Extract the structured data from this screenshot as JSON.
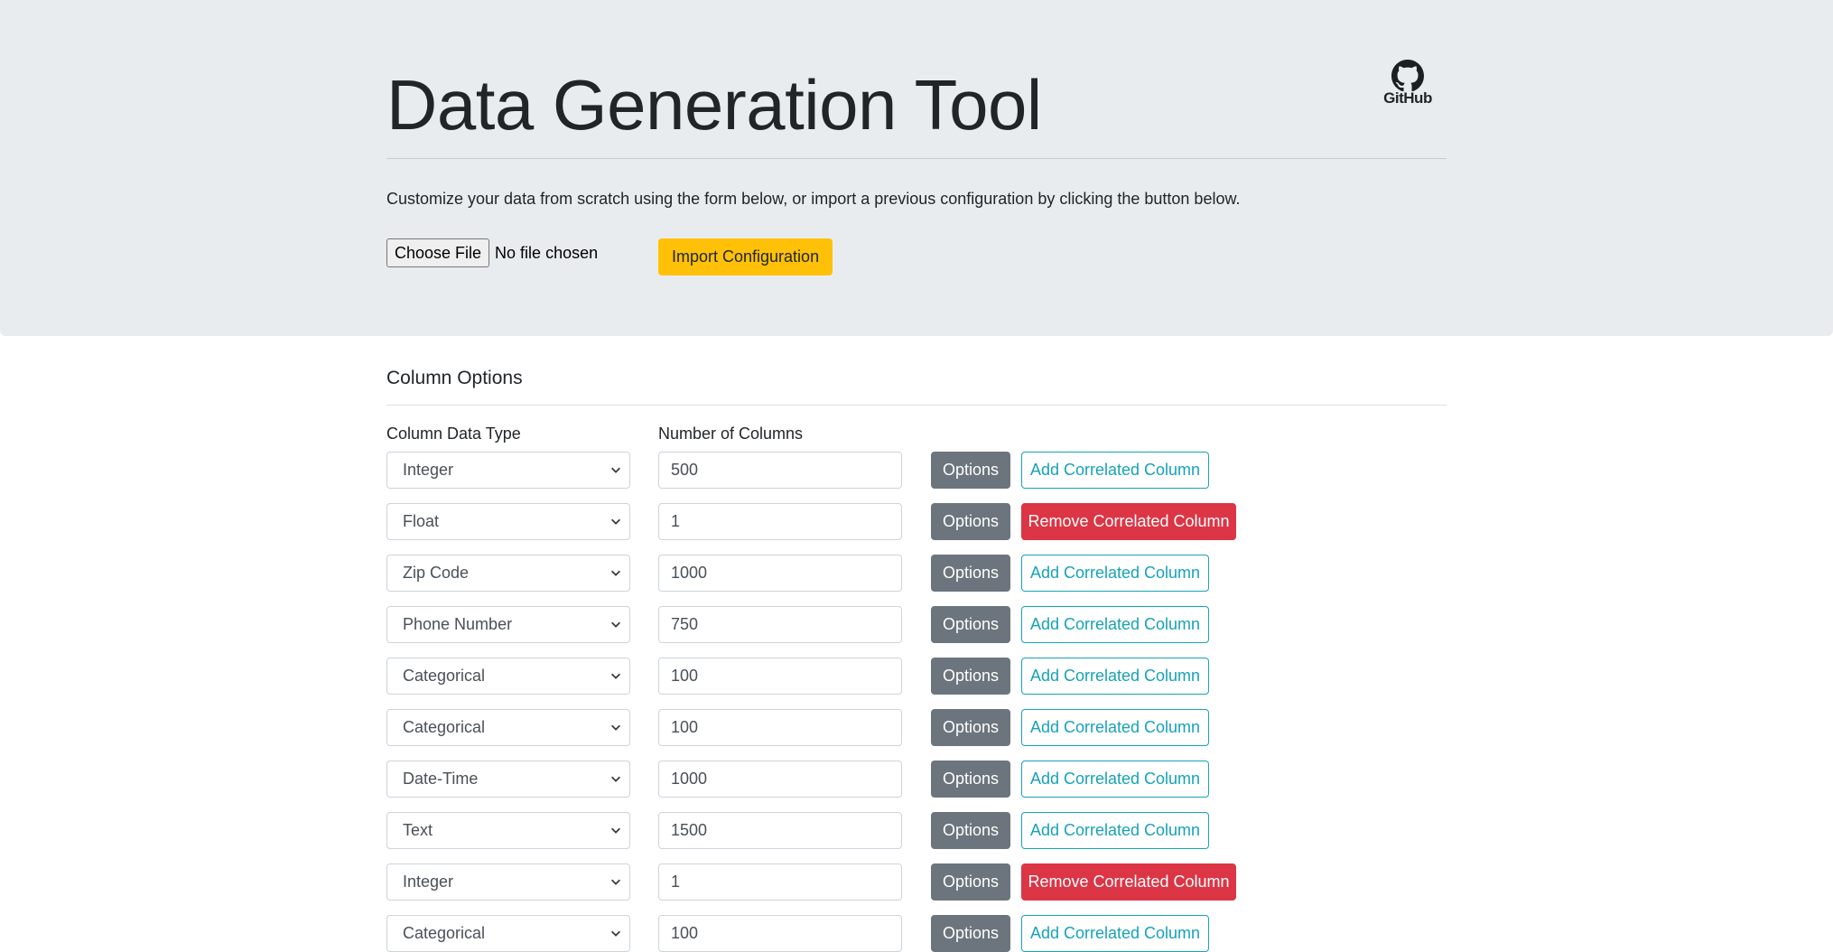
{
  "header": {
    "title": "Data Generation Tool",
    "github_label": "GitHub",
    "description": "Customize your data from scratch using the form below, or import a previous configuration by clicking the button below.",
    "file_button_label": "Choose File",
    "file_status": "No file chosen",
    "import_button_label": "Import Configuration"
  },
  "column_options": {
    "section_title": "Column Options",
    "data_type_label": "Column Data Type",
    "num_columns_label": "Number of Columns",
    "options_label": "Options",
    "add_corr_label": "Add Correlated Column",
    "remove_corr_label": "Remove Correlated Column",
    "rows": [
      {
        "type": "Integer",
        "count": "500",
        "correlated": "add"
      },
      {
        "type": "Float",
        "count": "1",
        "correlated": "remove"
      },
      {
        "type": "Zip Code",
        "count": "1000",
        "correlated": "add"
      },
      {
        "type": "Phone Number",
        "count": "750",
        "correlated": "add"
      },
      {
        "type": "Categorical",
        "count": "100",
        "correlated": "add"
      },
      {
        "type": "Categorical",
        "count": "100",
        "correlated": "add"
      },
      {
        "type": "Date-Time",
        "count": "1000",
        "correlated": "add"
      },
      {
        "type": "Text",
        "count": "1500",
        "correlated": "add"
      },
      {
        "type": "Integer",
        "count": "1",
        "correlated": "remove"
      },
      {
        "type": "Categorical",
        "count": "100",
        "correlated": "add"
      }
    ]
  },
  "colors": {
    "jumbotron_bg": "#e9ecef",
    "warning": "#ffc107",
    "secondary": "#6c757d",
    "info": "#17a2b8",
    "danger": "#dc3545"
  },
  "icons": {
    "github": "github-icon",
    "select_caret": "chevron-down-icon"
  }
}
